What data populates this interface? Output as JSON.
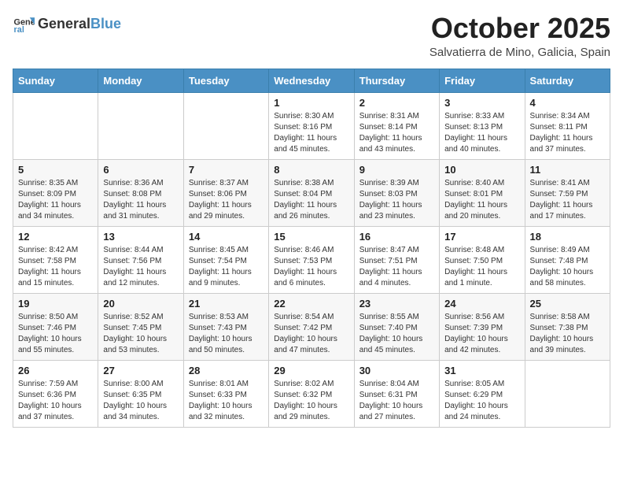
{
  "header": {
    "logo_general": "General",
    "logo_blue": "Blue",
    "title": "October 2025",
    "location": "Salvatierra de Mino, Galicia, Spain"
  },
  "weekdays": [
    "Sunday",
    "Monday",
    "Tuesday",
    "Wednesday",
    "Thursday",
    "Friday",
    "Saturday"
  ],
  "weeks": [
    [
      {
        "day": "",
        "info": ""
      },
      {
        "day": "",
        "info": ""
      },
      {
        "day": "",
        "info": ""
      },
      {
        "day": "1",
        "info": "Sunrise: 8:30 AM\nSunset: 8:16 PM\nDaylight: 11 hours\nand 45 minutes."
      },
      {
        "day": "2",
        "info": "Sunrise: 8:31 AM\nSunset: 8:14 PM\nDaylight: 11 hours\nand 43 minutes."
      },
      {
        "day": "3",
        "info": "Sunrise: 8:33 AM\nSunset: 8:13 PM\nDaylight: 11 hours\nand 40 minutes."
      },
      {
        "day": "4",
        "info": "Sunrise: 8:34 AM\nSunset: 8:11 PM\nDaylight: 11 hours\nand 37 minutes."
      }
    ],
    [
      {
        "day": "5",
        "info": "Sunrise: 8:35 AM\nSunset: 8:09 PM\nDaylight: 11 hours\nand 34 minutes."
      },
      {
        "day": "6",
        "info": "Sunrise: 8:36 AM\nSunset: 8:08 PM\nDaylight: 11 hours\nand 31 minutes."
      },
      {
        "day": "7",
        "info": "Sunrise: 8:37 AM\nSunset: 8:06 PM\nDaylight: 11 hours\nand 29 minutes."
      },
      {
        "day": "8",
        "info": "Sunrise: 8:38 AM\nSunset: 8:04 PM\nDaylight: 11 hours\nand 26 minutes."
      },
      {
        "day": "9",
        "info": "Sunrise: 8:39 AM\nSunset: 8:03 PM\nDaylight: 11 hours\nand 23 minutes."
      },
      {
        "day": "10",
        "info": "Sunrise: 8:40 AM\nSunset: 8:01 PM\nDaylight: 11 hours\nand 20 minutes."
      },
      {
        "day": "11",
        "info": "Sunrise: 8:41 AM\nSunset: 7:59 PM\nDaylight: 11 hours\nand 17 minutes."
      }
    ],
    [
      {
        "day": "12",
        "info": "Sunrise: 8:42 AM\nSunset: 7:58 PM\nDaylight: 11 hours\nand 15 minutes."
      },
      {
        "day": "13",
        "info": "Sunrise: 8:44 AM\nSunset: 7:56 PM\nDaylight: 11 hours\nand 12 minutes."
      },
      {
        "day": "14",
        "info": "Sunrise: 8:45 AM\nSunset: 7:54 PM\nDaylight: 11 hours\nand 9 minutes."
      },
      {
        "day": "15",
        "info": "Sunrise: 8:46 AM\nSunset: 7:53 PM\nDaylight: 11 hours\nand 6 minutes."
      },
      {
        "day": "16",
        "info": "Sunrise: 8:47 AM\nSunset: 7:51 PM\nDaylight: 11 hours\nand 4 minutes."
      },
      {
        "day": "17",
        "info": "Sunrise: 8:48 AM\nSunset: 7:50 PM\nDaylight: 11 hours\nand 1 minute."
      },
      {
        "day": "18",
        "info": "Sunrise: 8:49 AM\nSunset: 7:48 PM\nDaylight: 10 hours\nand 58 minutes."
      }
    ],
    [
      {
        "day": "19",
        "info": "Sunrise: 8:50 AM\nSunset: 7:46 PM\nDaylight: 10 hours\nand 55 minutes."
      },
      {
        "day": "20",
        "info": "Sunrise: 8:52 AM\nSunset: 7:45 PM\nDaylight: 10 hours\nand 53 minutes."
      },
      {
        "day": "21",
        "info": "Sunrise: 8:53 AM\nSunset: 7:43 PM\nDaylight: 10 hours\nand 50 minutes."
      },
      {
        "day": "22",
        "info": "Sunrise: 8:54 AM\nSunset: 7:42 PM\nDaylight: 10 hours\nand 47 minutes."
      },
      {
        "day": "23",
        "info": "Sunrise: 8:55 AM\nSunset: 7:40 PM\nDaylight: 10 hours\nand 45 minutes."
      },
      {
        "day": "24",
        "info": "Sunrise: 8:56 AM\nSunset: 7:39 PM\nDaylight: 10 hours\nand 42 minutes."
      },
      {
        "day": "25",
        "info": "Sunrise: 8:58 AM\nSunset: 7:38 PM\nDaylight: 10 hours\nand 39 minutes."
      }
    ],
    [
      {
        "day": "26",
        "info": "Sunrise: 7:59 AM\nSunset: 6:36 PM\nDaylight: 10 hours\nand 37 minutes."
      },
      {
        "day": "27",
        "info": "Sunrise: 8:00 AM\nSunset: 6:35 PM\nDaylight: 10 hours\nand 34 minutes."
      },
      {
        "day": "28",
        "info": "Sunrise: 8:01 AM\nSunset: 6:33 PM\nDaylight: 10 hours\nand 32 minutes."
      },
      {
        "day": "29",
        "info": "Sunrise: 8:02 AM\nSunset: 6:32 PM\nDaylight: 10 hours\nand 29 minutes."
      },
      {
        "day": "30",
        "info": "Sunrise: 8:04 AM\nSunset: 6:31 PM\nDaylight: 10 hours\nand 27 minutes."
      },
      {
        "day": "31",
        "info": "Sunrise: 8:05 AM\nSunset: 6:29 PM\nDaylight: 10 hours\nand 24 minutes."
      },
      {
        "day": "",
        "info": ""
      }
    ]
  ]
}
